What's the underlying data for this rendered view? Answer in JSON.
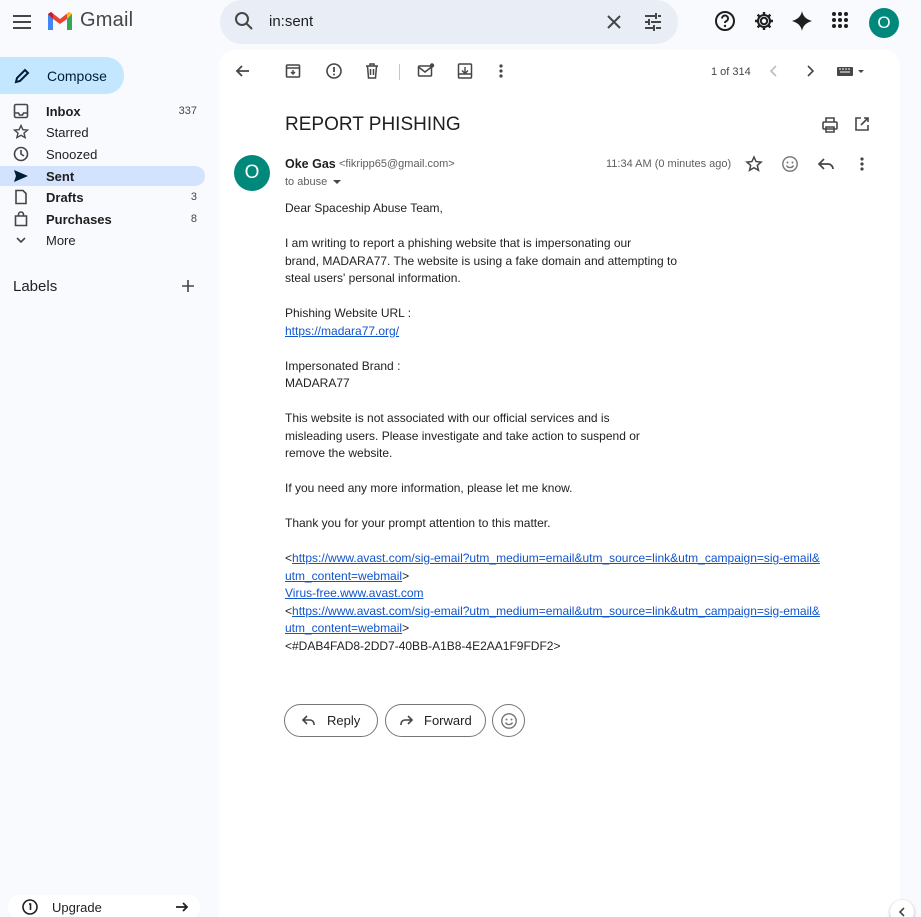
{
  "app": {
    "name": "Gmail"
  },
  "search": {
    "query": "in:sent"
  },
  "account": {
    "initial": "O"
  },
  "compose": {
    "label": "Compose"
  },
  "nav": [
    {
      "label": "Inbox",
      "count": "337",
      "icon": "inbox-icon",
      "bold": true
    },
    {
      "label": "Starred",
      "count": "",
      "icon": "star-icon",
      "bold": false
    },
    {
      "label": "Snoozed",
      "count": "",
      "icon": "clock-icon",
      "bold": false
    },
    {
      "label": "Sent",
      "count": "",
      "icon": "send-icon",
      "bold": true,
      "active": true
    },
    {
      "label": "Drafts",
      "count": "3",
      "icon": "draft-icon",
      "bold": true
    },
    {
      "label": "Purchases",
      "count": "8",
      "icon": "shopping-bag-icon",
      "bold": true
    },
    {
      "label": "More",
      "count": "",
      "icon": "chevron-down-icon",
      "bold": false
    }
  ],
  "labels": {
    "title": "Labels"
  },
  "upgrade": {
    "label": "Upgrade"
  },
  "toolbar": {
    "pager": "1 of 314"
  },
  "email": {
    "subject": "REPORT PHISHING",
    "sender_initial": "O",
    "sender_name": "Oke Gas",
    "sender_email": "<fikripp65@gmail.com>",
    "to": "to abuse",
    "timestamp": "11:34 AM (0 minutes ago)",
    "greeting": "Dear Spaceship Abuse Team,",
    "para1": "I am writing to report a phishing website that is impersonating our\nbrand, MADARA77. The website is using a fake domain and attempting to\nsteal users' personal information.",
    "url_label": "Phishing Website URL :",
    "url": "https://madara77.org/",
    "brand_label": "Impersonated Brand :",
    "brand": "MADARA77",
    "para2": "This website is not associated with our official services and is\nmisleading users. Please investigate and take action to suspend or\nremove the website.",
    "para3": "If you need any more information, please let me know.",
    "para4": "Thank you for your prompt attention to this matter.",
    "avast_link1a": "https://www.avast.com/sig-email?utm_medium=email&utm_source=link&utm_campaign=sig-email&",
    "avast_link1b": "utm_content=webmail",
    "virus_free": "Virus-free.www.avast.com",
    "avast_link2a": "https://www.avast.com/sig-email?utm_medium=email&utm_source=link&utm_campaign=sig-email&",
    "avast_link2b": "utm_content=webmail",
    "signature_id": "<#DAB4FAD8-2DD7-40BB-A1B8-4E2AA1F9FDF2>"
  },
  "actions": {
    "reply": "Reply",
    "forward": "Forward"
  },
  "colors": {
    "accent": "#c2e7ff",
    "avatar": "#00897b",
    "link": "#1155cc"
  }
}
